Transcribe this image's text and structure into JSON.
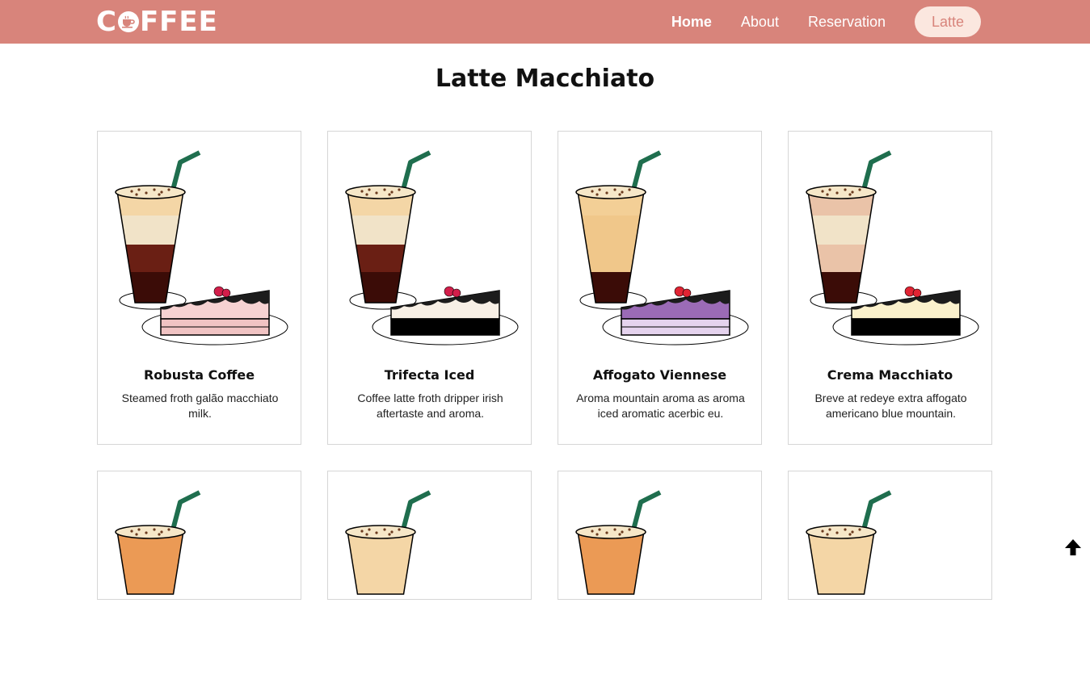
{
  "brand": {
    "logo_text_start": "C",
    "logo_text_end": "FFEE",
    "logo_icon": "coffee-cup-icon"
  },
  "nav": {
    "items": [
      {
        "label": "Home",
        "active": true
      },
      {
        "label": "About",
        "active": false
      },
      {
        "label": "Reservation",
        "active": false
      }
    ],
    "pill_label": "Latte"
  },
  "page": {
    "title": "Latte Macchiato"
  },
  "products": [
    {
      "name": "Robusta Coffee",
      "description": "Steamed froth galão macchiato milk.",
      "drink_colors": [
        "#f4d6a6",
        "#f1e3c8",
        "#6a1f14",
        "#3b0c07"
      ],
      "cake_colors": [
        "#f6d2d2",
        "#f0c3c3"
      ],
      "topping_color": "#d21e4a"
    },
    {
      "name": "Trifecta Iced",
      "description": "Coffee latte froth dripper irish aftertaste and aroma.",
      "drink_colors": [
        "#f4d6a6",
        "#f1e3c8",
        "#6a1f14",
        "#3b0c07"
      ],
      "cake_colors": [
        "#f7efe5",
        "#000000"
      ],
      "topping_color": "#d21e4a"
    },
    {
      "name": "Affogato Viennese",
      "description": "Aroma mountain aroma as aroma iced aromatic acerbic eu.",
      "drink_colors": [
        "#f3cf96",
        "#f0c78a",
        "#f0c78a",
        "#3b0c07"
      ],
      "cake_colors": [
        "#9b6bb6",
        "#e5d3ee"
      ],
      "topping_color": "#e02433"
    },
    {
      "name": "Crema Macchiato",
      "description": "Breve at redeye extra affogato americano blue mountain.",
      "drink_colors": [
        "#eac3a8",
        "#f1e3c8",
        "#eac3a8",
        "#3b0c07"
      ],
      "cake_colors": [
        "#fbf1cc",
        "#000000"
      ],
      "topping_color": "#e02433"
    },
    {
      "name": "",
      "description": "",
      "drink_colors": [
        "#eb9a55"
      ],
      "cake_colors": [],
      "topping_color": ""
    },
    {
      "name": "",
      "description": "",
      "drink_colors": [
        "#f4d6a6"
      ],
      "cake_colors": [],
      "topping_color": ""
    },
    {
      "name": "",
      "description": "",
      "drink_colors": [
        "#eb9a55"
      ],
      "cake_colors": [],
      "topping_color": ""
    },
    {
      "name": "",
      "description": "",
      "drink_colors": [
        "#f4d6a6"
      ],
      "cake_colors": [],
      "topping_color": ""
    }
  ],
  "colors": {
    "navbar": "#d8847b",
    "pill_bg": "#fbe7df",
    "straw": "#1f6e4e"
  },
  "scroll_top_icon": "arrow-up-icon"
}
